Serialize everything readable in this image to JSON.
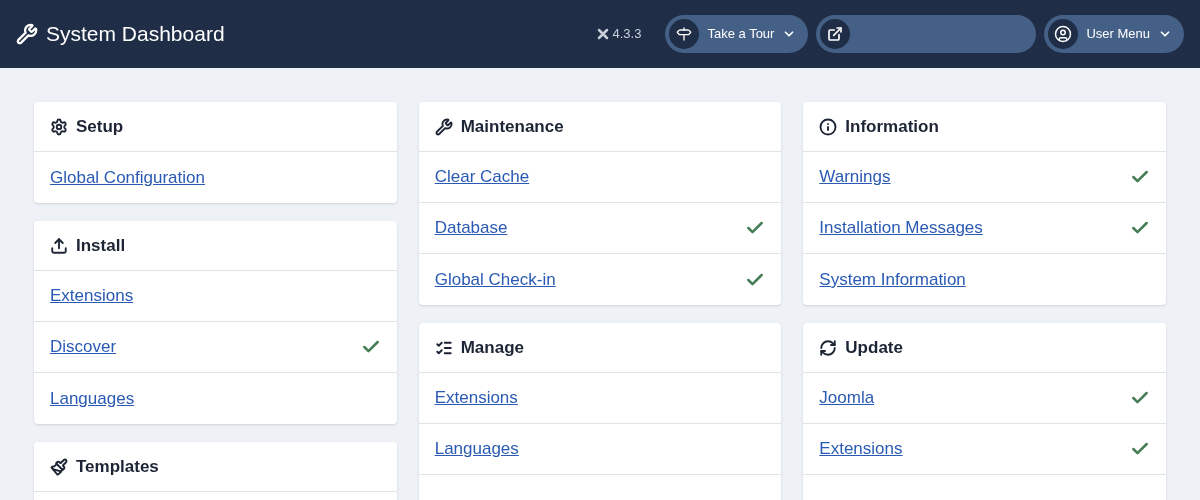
{
  "header": {
    "title": "System Dashboard",
    "version": "4.3.3",
    "tour_button": "Take a Tour",
    "user_menu": "User Menu"
  },
  "columns": [
    [
      {
        "title": "Setup",
        "items": [
          {
            "label": "Global Configuration",
            "checked": false
          }
        ]
      },
      {
        "title": "Install",
        "items": [
          {
            "label": "Extensions",
            "checked": false
          },
          {
            "label": "Discover",
            "checked": true
          },
          {
            "label": "Languages",
            "checked": false
          }
        ]
      },
      {
        "title": "Templates"
      }
    ],
    [
      {
        "title": "Maintenance",
        "items": [
          {
            "label": "Clear Cache",
            "checked": false
          },
          {
            "label": "Database",
            "checked": true
          },
          {
            "label": "Global Check-in",
            "checked": true
          }
        ]
      },
      {
        "title": "Manage",
        "items": [
          {
            "label": "Extensions",
            "checked": false
          },
          {
            "label": "Languages",
            "checked": false
          }
        ]
      }
    ],
    [
      {
        "title": "Information",
        "items": [
          {
            "label": "Warnings",
            "checked": true
          },
          {
            "label": "Installation Messages",
            "checked": true
          },
          {
            "label": "System Information",
            "checked": false
          }
        ]
      },
      {
        "title": "Update",
        "items": [
          {
            "label": "Joomla",
            "checked": true
          },
          {
            "label": "Extensions",
            "checked": true
          }
        ]
      }
    ]
  ]
}
